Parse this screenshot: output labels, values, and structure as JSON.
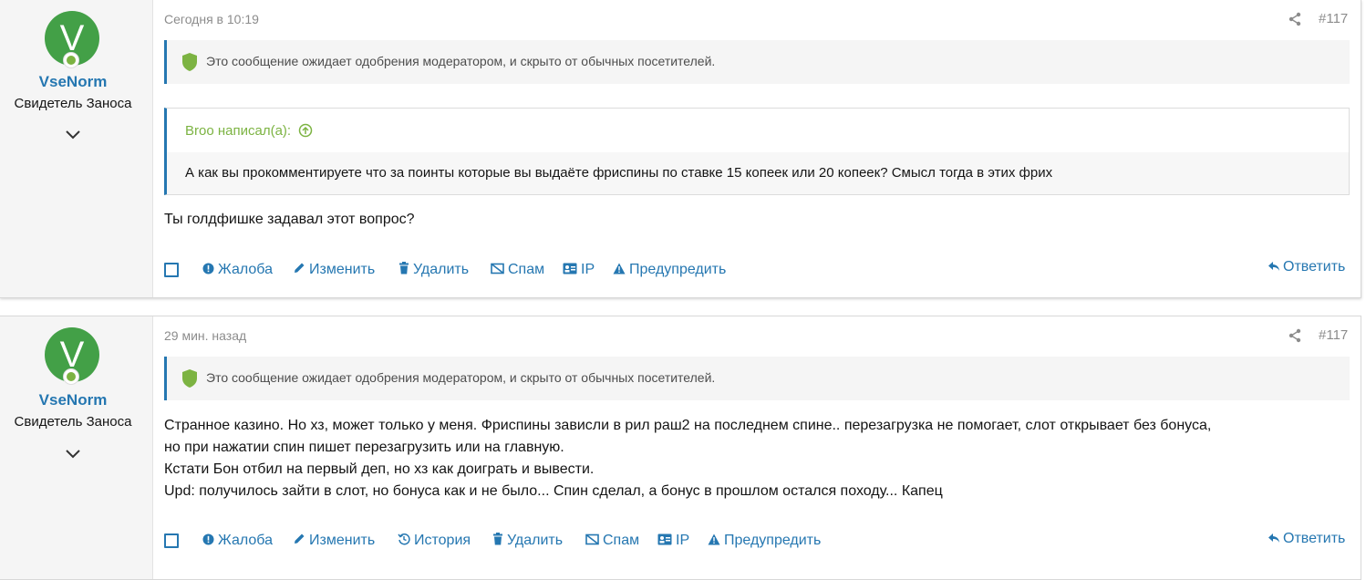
{
  "posts": [
    {
      "user": {
        "avatar_letter": "V",
        "name": "VseNorm",
        "title": "Свидетель Заноса"
      },
      "date": "Сегодня в 10:19",
      "number": "#117",
      "moderation": "Это сообщение ожидает одобрения модератором, и скрыто от обычных посетителей.",
      "quote": {
        "author": "Broo написал(а):",
        "text": "А как вы прокомментируете что за поинты которые вы выдаёте фриспины по ставке 15 копеек или 20 копеек? Смысл тогда в этих фрих"
      },
      "body": [
        "Ты голдфишке задавал этот вопрос?"
      ],
      "actions": {
        "report": "Жалоба",
        "edit": "Изменить",
        "delete": "Удалить",
        "spam": "Спам",
        "ip": "IP",
        "warn": "Предупредить"
      },
      "reply": "Ответить"
    },
    {
      "user": {
        "avatar_letter": "V",
        "name": "VseNorm",
        "title": "Свидетель Заноса"
      },
      "date": "29 мин. назад",
      "number": "#117",
      "moderation": "Это сообщение ожидает одобрения модератором, и скрыто от обычных посетителей.",
      "body": [
        "Странное казино. Но хз, может только у меня. Фриспины зависли в рил раш2 на последнем спине.. перезагрузка не помогает, слот открывает без бонуса,",
        "но при нажатии спин пишет перезагрузить или на главную.",
        "Кстати Бон отбил на первый деп, но хз как доиграть и вывести.",
        "Upd: получилось зайти в слот, но бонуса как и не было... Спин сделал, а бонус в прошлом остался походу... Капец"
      ],
      "actions": {
        "report": "Жалоба",
        "edit": "Изменить",
        "history": "История",
        "delete": "Удалить",
        "spam": "Спам",
        "ip": "IP",
        "warn": "Предупредить"
      },
      "reply": "Ответить"
    }
  ],
  "colors": {
    "link": "#2577b1",
    "avatar": "#43a047",
    "online": "#7cb342",
    "quote_author": "#7cb342"
  }
}
